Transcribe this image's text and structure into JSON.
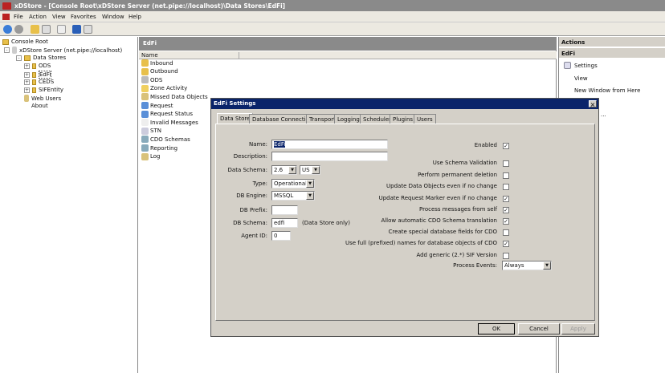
{
  "window": {
    "title": "xDStore - [Console Root\\xDStore Server (net.pipe://localhost)\\Data Stores\\EdFi]"
  },
  "menu": [
    "File",
    "Action",
    "View",
    "Favorites",
    "Window",
    "Help"
  ],
  "tree": {
    "root": "Console Root",
    "server": "xDStore Server (net.pipe://localhost)",
    "data_stores": "Data Stores",
    "stores": [
      "ODS",
      "EdFi",
      "CEDS",
      "SIFEntity"
    ],
    "web_users": "Web Users",
    "about": "About"
  },
  "middle": {
    "title": "EdFi",
    "column": "Name",
    "items": [
      "Inbound",
      "Outbound",
      "ODS",
      "Zone Activity",
      "Missed Data Objects",
      "Request",
      "Request Status",
      "Invalid Messages",
      "STN",
      "CDO Schemas",
      "Reporting",
      "Log"
    ]
  },
  "actions": {
    "header": "Actions",
    "section": "EdFi",
    "items": [
      "Settings",
      "View",
      "New Window from Here"
    ],
    "more": "..."
  },
  "dialog": {
    "title": "EdFi Settings",
    "tabs": [
      "Data Store",
      "Database Connection",
      "Transport",
      "Logging",
      "Schedules",
      "Plugins",
      "Users"
    ],
    "fields": {
      "name": {
        "label": "Name:",
        "value": "EdFi"
      },
      "description": {
        "label": "Description:",
        "value": ""
      },
      "data_schema": {
        "label": "Data Schema:",
        "version": "2.6",
        "locale": "US"
      },
      "type": {
        "label": "Type:",
        "value": "Operational"
      },
      "db_engine": {
        "label": "DB Engine:",
        "value": "MSSQL"
      },
      "db_prefix": {
        "label": "DB Prefix:",
        "value": ""
      },
      "db_schema": {
        "label": "DB Schema:",
        "value": "edfi",
        "note": "(Data Store only)"
      },
      "agent_id": {
        "label": "Agent ID:",
        "value": "0"
      }
    },
    "checkboxes": [
      {
        "label": "Enabled",
        "checked": true
      },
      {
        "label": "Use Schema Validation",
        "checked": false
      },
      {
        "label": "Perform permanent deletion",
        "checked": false
      },
      {
        "label": "Update Data Objects even if no change",
        "checked": false
      },
      {
        "label": "Update Request Marker even if no change",
        "checked": true
      },
      {
        "label": "Process messages from self",
        "checked": true
      },
      {
        "label": "Allow automatic CDO Schema translation",
        "checked": true
      },
      {
        "label": "Create special database fields for CDO",
        "checked": false
      },
      {
        "label": "Use full (prefixed) names for database objects of CDO",
        "checked": true
      },
      {
        "label": "Add generic (2.*) SIF Version",
        "checked": false
      }
    ],
    "process_events": {
      "label": "Process Events:",
      "value": "Always"
    },
    "buttons": {
      "ok": "OK",
      "cancel": "Cancel",
      "apply": "Apply"
    }
  }
}
